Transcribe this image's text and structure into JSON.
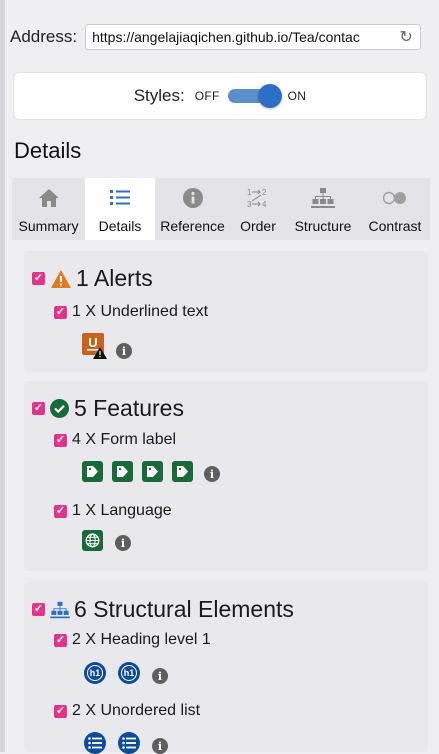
{
  "address": {
    "label": "Address:",
    "url": "https://angelajiaqichen.github.io/Tea/contac"
  },
  "styles_toggle": {
    "label": "Styles:",
    "off_label": "OFF",
    "on_label": "ON",
    "state": "on"
  },
  "section_heading": "Details",
  "tabs": [
    {
      "label": "Summary",
      "icon": "home-icon",
      "active": false
    },
    {
      "label": "Details",
      "icon": "list-icon",
      "active": true
    },
    {
      "label": "Reference",
      "icon": "info-icon",
      "active": false
    },
    {
      "label": "Order",
      "icon": "order-icon",
      "active": false
    },
    {
      "label": "Structure",
      "icon": "structure-icon",
      "active": false
    },
    {
      "label": "Contrast",
      "icon": "contrast-icon",
      "active": false
    }
  ],
  "alerts": {
    "title": "1 Alerts",
    "items": [
      {
        "label": "1 X Underlined text",
        "icon": "underline-alert-icon",
        "count": 1
      }
    ]
  },
  "features": {
    "title": "5 Features",
    "items": [
      {
        "label": "4 X Form label",
        "icon": "form-label-icon",
        "count": 4
      },
      {
        "label": "1 X Language",
        "icon": "language-icon",
        "count": 1
      }
    ]
  },
  "structural": {
    "title": "6 Structural Elements",
    "items": [
      {
        "label": "2 X Heading level 1",
        "icon": "h1-icon",
        "count": 2,
        "badge_text": "h1"
      },
      {
        "label": "2 X Unordered list",
        "icon": "unordered-list-icon",
        "count": 2
      }
    ]
  },
  "colors": {
    "checkbox": "#e6338a",
    "alert_orange": "#e07b1f",
    "feature_green": "#186b39",
    "structure_blue": "#0f4c97",
    "toggle_blue": "#2c6ec6"
  }
}
